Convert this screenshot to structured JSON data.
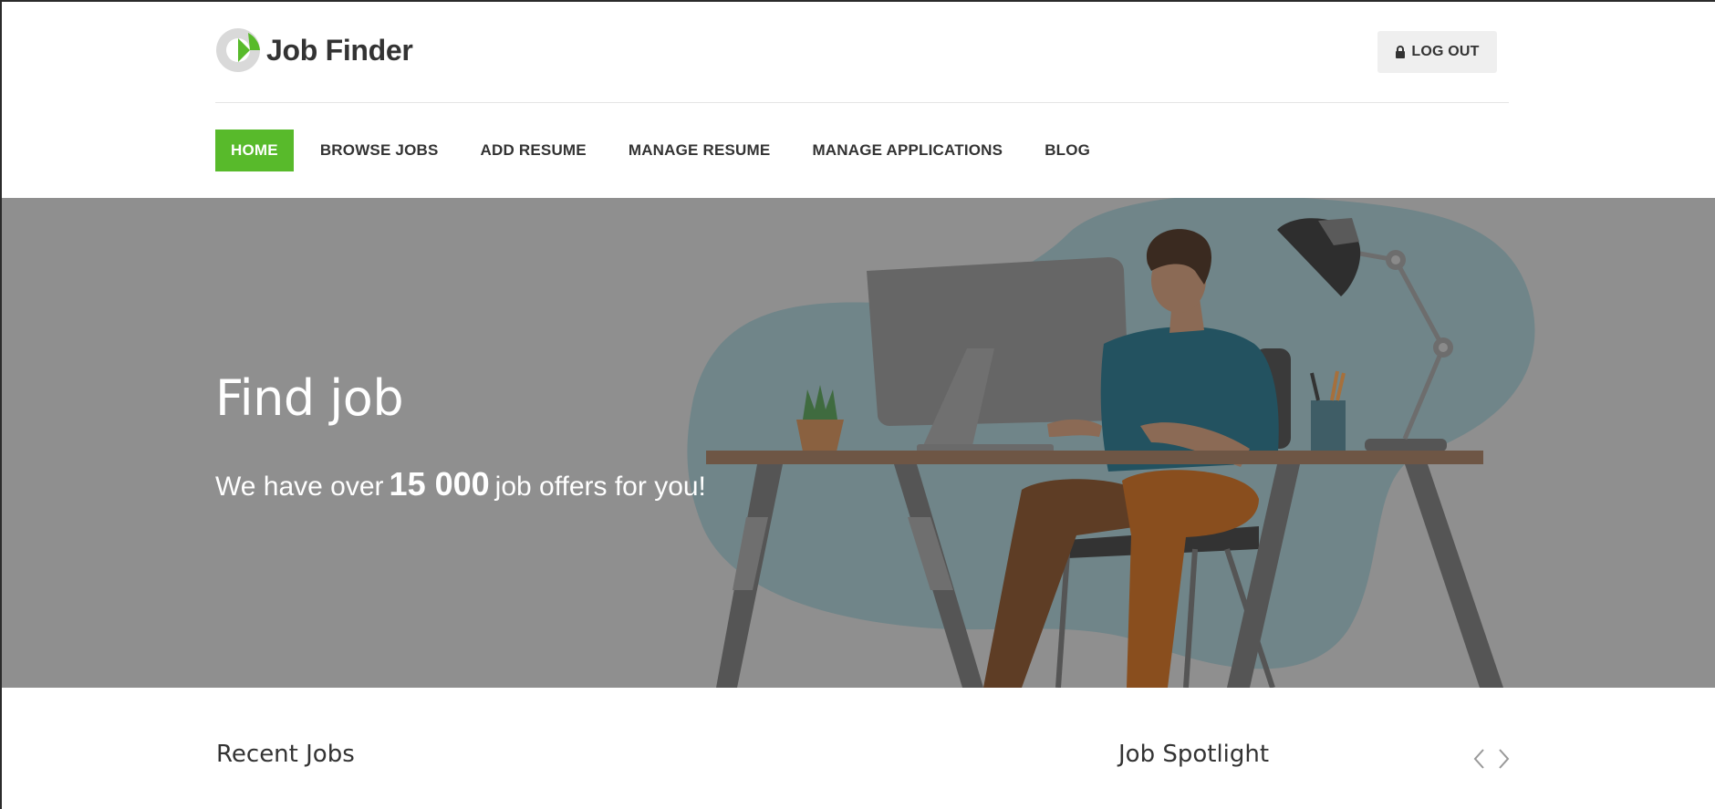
{
  "header": {
    "brand": "Job Finder",
    "logout_label": "LOG OUT",
    "logout_icon": "lock-icon"
  },
  "nav": {
    "items": [
      {
        "label": "HOME",
        "active": true
      },
      {
        "label": "BROWSE JOBS",
        "active": false
      },
      {
        "label": "ADD RESUME",
        "active": false
      },
      {
        "label": "MANAGE RESUME",
        "active": false
      },
      {
        "label": "MANAGE APPLICATIONS",
        "active": false
      },
      {
        "label": "BLOG",
        "active": false
      }
    ]
  },
  "hero": {
    "title": "Find job",
    "sub_before": "We have over",
    "count": "15 000",
    "sub_after": "job offers for you!"
  },
  "sections": {
    "recent_jobs": "Recent Jobs",
    "job_spotlight": "Job Spotlight"
  },
  "colors": {
    "accent": "#58ba2b",
    "hero_overlay": "#8f8f8f"
  },
  "icons": {
    "prev": "chevron-left-icon",
    "next": "chevron-right-icon"
  }
}
